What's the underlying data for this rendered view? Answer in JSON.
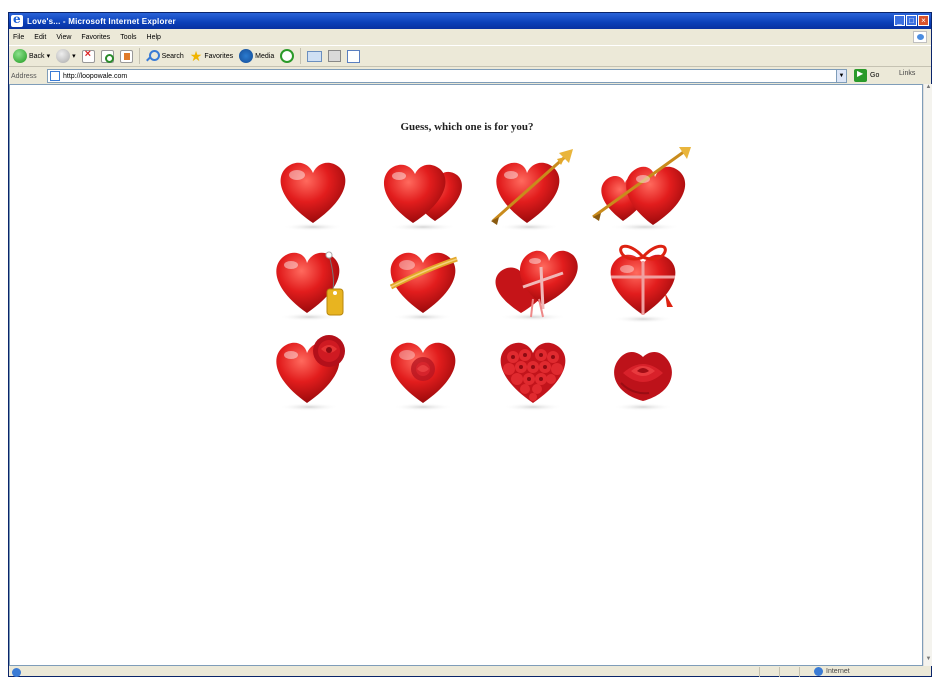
{
  "window": {
    "title": "Love's... - Microsoft Internet Explorer",
    "controls": [
      "_",
      "□",
      "×"
    ]
  },
  "menu": [
    "File",
    "Edit",
    "View",
    "Favorites",
    "Tools",
    "Help"
  ],
  "toolbar": {
    "back": "Back",
    "search": "Search",
    "favorites": "Favorites",
    "media": "Media"
  },
  "address": {
    "label": "Address",
    "url": "http://loopowale.com",
    "go": "Go",
    "links": "Links"
  },
  "page": {
    "question": "Guess, which one is for you?"
  },
  "hearts": [
    {
      "variant": "plain"
    },
    {
      "variant": "double"
    },
    {
      "variant": "arrow"
    },
    {
      "variant": "double-arrow"
    },
    {
      "variant": "tag"
    },
    {
      "variant": "ribbon"
    },
    {
      "variant": "gift-box"
    },
    {
      "variant": "bow"
    },
    {
      "variant": "rose-corner"
    },
    {
      "variant": "rose-inside"
    },
    {
      "variant": "roses-cluster"
    },
    {
      "variant": "rose"
    }
  ],
  "status": {
    "zone": "Internet"
  },
  "colors": {
    "heart": "#d8161b",
    "heart_dark": "#a00d10",
    "gold": "#e3a72a",
    "titlebar": "#0a3fb8"
  }
}
